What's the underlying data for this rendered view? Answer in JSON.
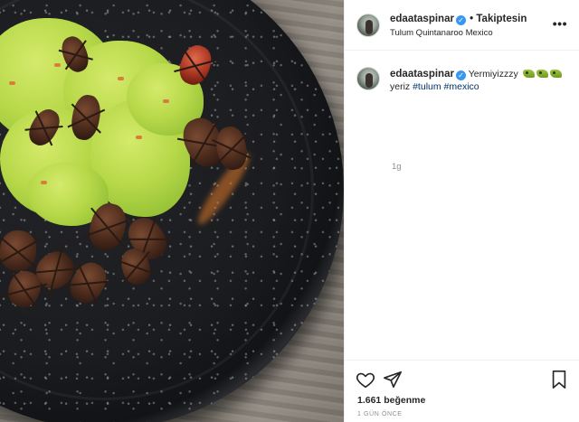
{
  "post": {
    "username": "edaataspinar",
    "follow_label": "• Takiptesin",
    "location": "Tulum Quintanaroo Mexico",
    "more_label": "•••",
    "caption": {
      "username": "edaataspinar",
      "text_before": "Yermiyizzzy",
      "text_after": "yeriz",
      "hashtags": [
        "#tulum",
        "#mexico"
      ]
    },
    "comment_time": "1g",
    "likes_label": "1.661 beğenme",
    "date_label": "1 GÜN ÖNCE"
  },
  "icons": {
    "verified": "verified-badge-icon",
    "like": "heart-icon",
    "share": "paper-plane-icon",
    "save": "bookmark-icon",
    "emoji": "cricket-emoji-icon"
  },
  "colors": {
    "verified": "#3897f0",
    "link": "#003569",
    "muted": "#8e8e8e",
    "text": "#262626"
  }
}
